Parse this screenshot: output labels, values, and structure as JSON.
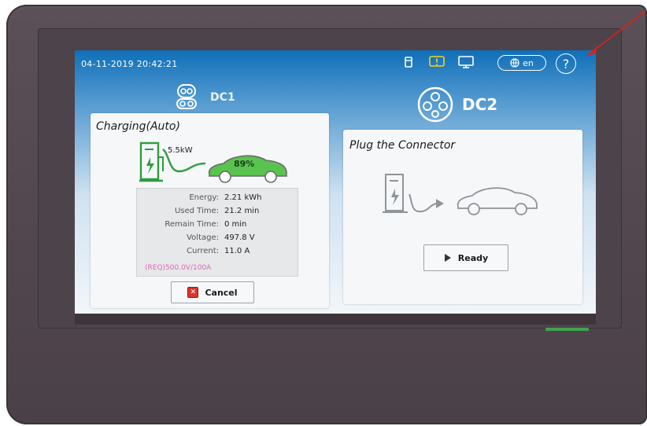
{
  "status_bar": {
    "datetime": "04-11-2019 20:42:21",
    "language": "en",
    "help": "?"
  },
  "dc1": {
    "label": "DC1",
    "panel_title": "Charging(Auto)",
    "power": "5.5kW",
    "battery_percent": "89%",
    "rows": [
      {
        "label": "Energy:",
        "value": "2.21 kWh"
      },
      {
        "label": "Used Time:",
        "value": "21.2 min"
      },
      {
        "label": "Remain Time:",
        "value": "0 min"
      },
      {
        "label": "Voltage:",
        "value": "497.8 V"
      },
      {
        "label": "Current:",
        "value": "11.0 A"
      }
    ],
    "request": "(REQ)500.0V/100A",
    "cancel_label": "Cancel"
  },
  "dc2": {
    "label": "DC2",
    "panel_title": "Plug the Connector",
    "ready_label": "Ready"
  },
  "colors": {
    "screen_top": "#0f6fb8",
    "battery_green": "#5ac34f",
    "alert_yellow": "#f2d21f",
    "request_pink": "#e066b8",
    "cancel_red": "#d9362b",
    "arrow_red": "#e0201a"
  },
  "icons": [
    "storage-icon",
    "alert-icon",
    "monitor-icon",
    "globe-icon",
    "help-icon",
    "connector-icon",
    "charger-icon",
    "car-icon",
    "play-icon",
    "cancel-x-icon"
  ]
}
